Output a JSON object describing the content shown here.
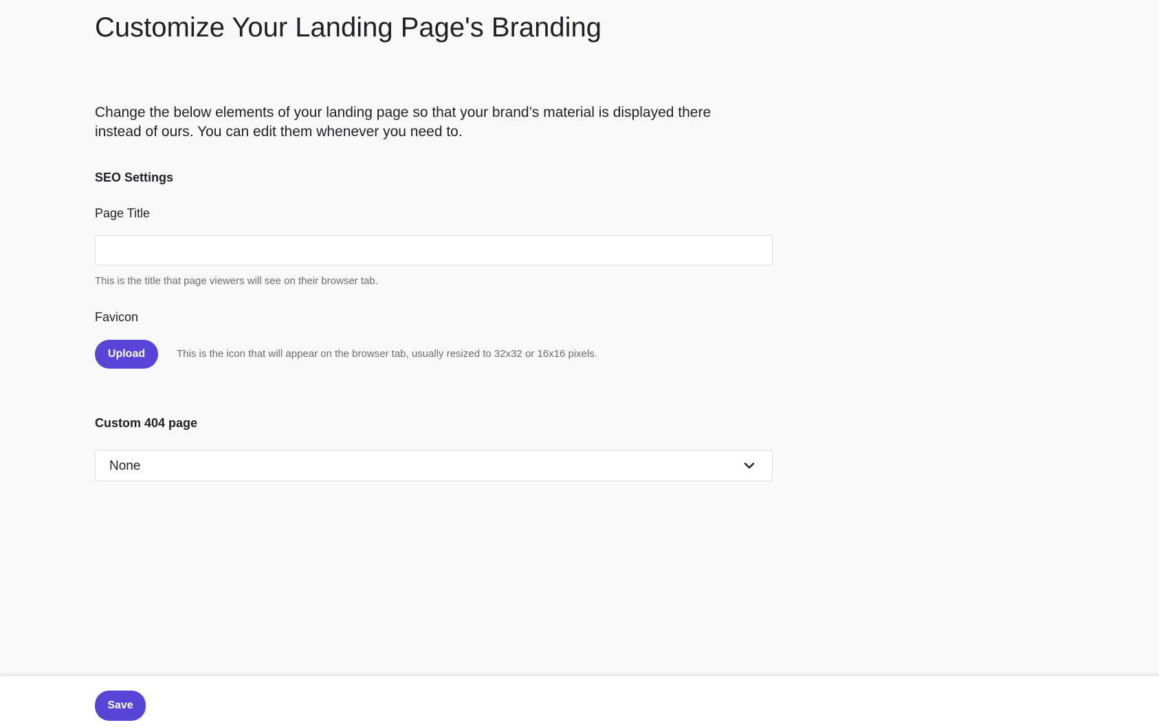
{
  "header": {
    "title": "Customize Your Landing Page's Branding"
  },
  "intro": {
    "text": "Change the below elements of your landing page so that your brand’s material is displayed there instead of ours. You can edit them whenever you need to."
  },
  "seo": {
    "heading": "SEO Settings",
    "page_title": {
      "label": "Page Title",
      "value": "",
      "placeholder": "",
      "hint": "This is the title that page viewers will see on their browser tab."
    },
    "favicon": {
      "label": "Favicon",
      "upload_label": "Upload",
      "hint": "This is the icon that will appear on the browser tab, usually resized to 32x32 or 16x16 pixels."
    }
  },
  "custom_404": {
    "heading": "Custom 404 page",
    "selected": "None",
    "icon": "chevron-down-icon"
  },
  "footer": {
    "save_label": "Save"
  },
  "colors": {
    "accent": "#5845d8",
    "page_background": "#f9f9f9",
    "text": "#1f1f24",
    "hint_text": "#6b6b70"
  }
}
